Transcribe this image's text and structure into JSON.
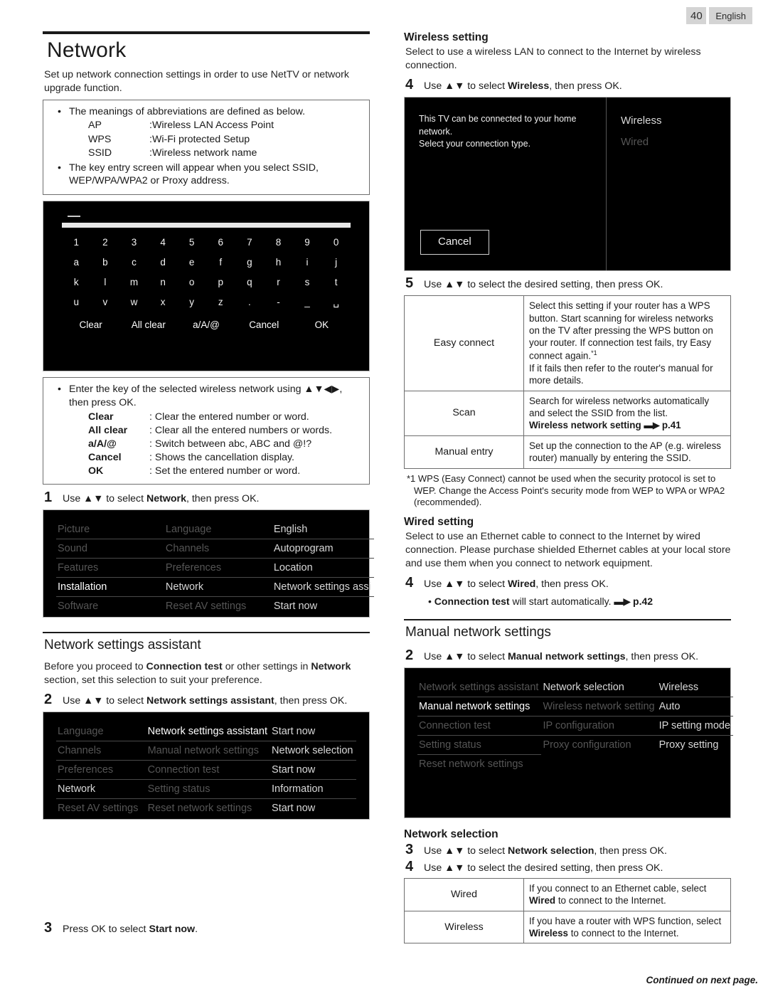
{
  "header": {
    "page_number": "40",
    "language": "English"
  },
  "left": {
    "title": "Network",
    "intro": "Set up network connection settings in order to use NetTV or network upgrade function.",
    "notebox1": {
      "bullet1": "The meanings of abbreviations are defined as below.",
      "defs": [
        {
          "key": "AP",
          "val": ":Wireless LAN Access Point"
        },
        {
          "key": "WPS",
          "val": ":Wi-Fi protected Setup"
        },
        {
          "key": "SSID",
          "val": ":Wireless network name"
        }
      ],
      "bullet2": "The key entry screen will appear when you select SSID, WEP/WPA/WPA2 or Proxy address."
    },
    "keyboard": {
      "row_numbers": [
        "1",
        "2",
        "3",
        "4",
        "5",
        "6",
        "7",
        "8",
        "9",
        "0"
      ],
      "row_a": [
        "a",
        "b",
        "c",
        "d",
        "e",
        "f",
        "g",
        "h",
        "i",
        "j"
      ],
      "row_k": [
        "k",
        "l",
        "m",
        "n",
        "o",
        "p",
        "q",
        "r",
        "s",
        "t"
      ],
      "row_u": [
        "u",
        "v",
        "w",
        "x",
        "y",
        "z",
        ".",
        "-",
        "_",
        "␣"
      ],
      "functions": [
        "Clear",
        "All clear",
        "a/A/@",
        "Cancel",
        "OK"
      ]
    },
    "notebox2": {
      "bullet1": "Enter the key of the selected wireless network using ▲▼◀▶, then press OK.",
      "defs": [
        {
          "key": "Clear",
          "val": ": Clear the entered number or word."
        },
        {
          "key": "All clear",
          "val": ": Clear all the entered numbers or words."
        },
        {
          "key": "a/A/@",
          "val": ": Switch between abc, ABC and @!?"
        },
        {
          "key": "Cancel",
          "val": ": Shows the cancellation display."
        },
        {
          "key": "OK",
          "val": ": Set the entered number or word."
        }
      ]
    },
    "step1": {
      "num": "1",
      "pre": "Use ▲▼ to select ",
      "bold": "Network",
      "post": ", then press OK."
    },
    "menu1": {
      "col1": [
        {
          "label": "Picture",
          "level": "dim"
        },
        {
          "label": "Sound",
          "level": "dim"
        },
        {
          "label": "Features",
          "level": "dim"
        },
        {
          "label": "Installation",
          "level": "on"
        },
        {
          "label": "Software",
          "level": "dim"
        }
      ],
      "col2": [
        {
          "label": "Language",
          "level": "dim"
        },
        {
          "label": "Channels",
          "level": "dim"
        },
        {
          "label": "Preferences",
          "level": "dim"
        },
        {
          "label": "Network",
          "level": "norm"
        },
        {
          "label": "Reset AV settings",
          "level": "dim"
        }
      ],
      "col3": [
        {
          "label": "English",
          "level": "norm"
        },
        {
          "label": "Autoprogram",
          "level": "norm"
        },
        {
          "label": "Location",
          "level": "norm"
        },
        {
          "label": "Network settings assi",
          "level": "norm"
        },
        {
          "label": "Start now",
          "level": "norm"
        }
      ]
    },
    "assistant": {
      "heading": "Network settings assistant",
      "body_pre": "Before you proceed to ",
      "body_b1": "Connection test",
      "body_mid": " or other settings in ",
      "body_b2": "Network",
      "body_post": " section, set this selection to suit your preference.",
      "step2": {
        "num": "2",
        "pre": "Use ▲▼ to select ",
        "bold": "Network settings assistant",
        "post": ", then press OK."
      },
      "menu2": {
        "col1": [
          {
            "label": "Language",
            "level": "dim"
          },
          {
            "label": "Channels",
            "level": "dim"
          },
          {
            "label": "Preferences",
            "level": "dim"
          },
          {
            "label": "Network",
            "level": "norm"
          },
          {
            "label": "Reset AV settings",
            "level": "dim"
          }
        ],
        "col2": [
          {
            "label": "Network settings assistant",
            "level": "on"
          },
          {
            "label": "Manual network settings",
            "level": "dim"
          },
          {
            "label": "Connection test",
            "level": "dim"
          },
          {
            "label": "Setting status",
            "level": "dim"
          },
          {
            "label": "Reset network settings",
            "level": "dim"
          }
        ],
        "col3": [
          {
            "label": "Start now",
            "level": "norm"
          },
          {
            "label": "Network selection",
            "level": "norm"
          },
          {
            "label": "Start now",
            "level": "norm"
          },
          {
            "label": "Information",
            "level": "norm"
          },
          {
            "label": "Start now",
            "level": "norm"
          }
        ]
      },
      "step3": {
        "num": "3",
        "pre": "Press OK to select ",
        "bold": "Start now",
        "post": "."
      }
    }
  },
  "right": {
    "wireless": {
      "heading": "Wireless setting",
      "body": "Select to use a wireless LAN to connect to the Internet by wireless connection.",
      "step4": {
        "num": "4",
        "pre": "Use ▲▼ to select ",
        "bold": "Wireless",
        "post": ", then press OK."
      },
      "screen": {
        "message_line1": "This TV can be connected to your home network.",
        "message_line2": "Select your connection type.",
        "option_wireless": "Wireless",
        "option_wired": "Wired",
        "cancel": "Cancel"
      },
      "step5": {
        "num": "5",
        "pre": "Use ▲▼ to select the desired setting, then press OK.",
        "bold": "",
        "post": ""
      },
      "table": [
        {
          "label": "Easy connect",
          "desc": "Select this setting if your router has a WPS button. Start scanning for wireless networks on the TV after pressing the WPS button on your router. If connection test fails, try Easy connect again.",
          "sup": "*1",
          "desc2": "If it fails then refer to the router's manual for more details."
        },
        {
          "label": "Scan",
          "desc": "Search for wireless networks automatically and select the SSID from the list.",
          "link_bold": "Wireless network setting",
          "link_page": "p.41"
        },
        {
          "label": "Manual entry",
          "desc": "Set up the connection to the AP (e.g. wireless router) manually by entering the SSID."
        }
      ],
      "footnote": "*1 WPS (Easy Connect) cannot be used when the security protocol is set to WEP. Change the Access Point's security mode from WEP to WPA or WPA2 (recommended)."
    },
    "wired": {
      "heading": "Wired setting",
      "body": "Select to use an Ethernet cable to connect to the Internet by wired connection. Please purchase shielded Ethernet cables at your local store and use them when you connect to network equipment.",
      "step4": {
        "num": "4",
        "pre": "Use ▲▼ to select ",
        "bold": "Wired",
        "post": ", then press OK."
      },
      "bullet_pre": "• ",
      "bullet_b": "Connection test",
      "bullet_post": " will start automatically. ",
      "bullet_page": "p.42"
    },
    "manual": {
      "heading": "Manual network settings",
      "step2": {
        "num": "2",
        "pre": "Use ▲▼ to select ",
        "bold": "Manual network settings",
        "post": ", then press OK."
      },
      "menu": {
        "col1": [
          {
            "label": "Network settings assistant",
            "level": "dim"
          },
          {
            "label": "Manual network settings",
            "level": "on"
          },
          {
            "label": "Connection test",
            "level": "dim"
          },
          {
            "label": "Setting status",
            "level": "dim"
          },
          {
            "label": "Reset network settings",
            "level": "dim"
          }
        ],
        "col2": [
          {
            "label": "Network selection",
            "level": "norm"
          },
          {
            "label": "Wireless network setting",
            "level": "dim"
          },
          {
            "label": "IP configuration",
            "level": "dim"
          },
          {
            "label": "Proxy configuration",
            "level": "dim"
          }
        ],
        "col3": [
          {
            "label": "Wireless",
            "level": "norm"
          },
          {
            "label": "Auto",
            "level": "norm"
          },
          {
            "label": "IP setting mode",
            "level": "norm"
          },
          {
            "label": "Proxy setting",
            "level": "norm"
          }
        ]
      }
    },
    "selection": {
      "heading": "Network selection",
      "step3": {
        "num": "3",
        "pre": "Use ▲▼ to select ",
        "bold": "Network selection",
        "post": ", then press OK."
      },
      "step4": {
        "num": "4",
        "pre": "Use ▲▼ to select the desired setting, then press OK.",
        "bold": "",
        "post": ""
      },
      "table": [
        {
          "label": "Wired",
          "pre": "If you connect to an Ethernet cable, select ",
          "bold": "Wired",
          "post": " to connect to the Internet."
        },
        {
          "label": "Wireless",
          "pre": "If you have a router with WPS function, select ",
          "bold": "Wireless",
          "post": " to connect to the Internet."
        }
      ]
    },
    "continued": "Continued on next page."
  }
}
